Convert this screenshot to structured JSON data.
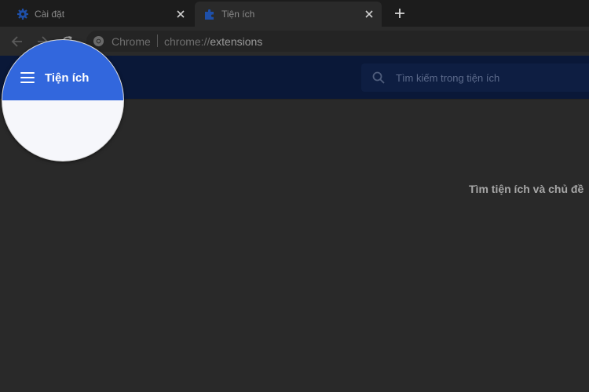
{
  "tabs": [
    {
      "title": "Cài đặt",
      "icon": "gear-icon"
    },
    {
      "title": "Tiện ích",
      "icon": "puzzle-icon"
    }
  ],
  "toolbar": {
    "site_label": "Chrome",
    "url_prefix": "chrome://",
    "url_host": "extensions"
  },
  "extensions": {
    "search_placeholder": "Tìm kiếm trong tiện ích",
    "empty_message": "Tìm tiện ích và chủ đề"
  },
  "magnifier": {
    "title": "Tiện ích"
  },
  "colors": {
    "header_bg": "#0a1838",
    "accent_blue": "#3267dd",
    "page_bg": "#292929"
  }
}
